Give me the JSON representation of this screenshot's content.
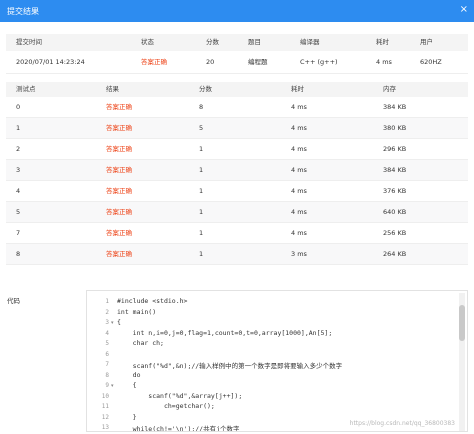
{
  "window": {
    "title": "提交结果",
    "close_glyph": "×"
  },
  "summary": {
    "headers": [
      "提交时间",
      "状态",
      "分数",
      "题目",
      "编译器",
      "耗时",
      "用户"
    ],
    "values": [
      "2020/07/01 14:23:24",
      "答案正确",
      "20",
      "编程题",
      "C++ (g++)",
      "4 ms",
      "620HZ"
    ]
  },
  "tests": {
    "headers": [
      "测试点",
      "结果",
      "分数",
      "耗时",
      "内存"
    ],
    "rows": [
      [
        "0",
        "答案正确",
        "8",
        "4 ms",
        "384 KB"
      ],
      [
        "1",
        "答案正确",
        "5",
        "4 ms",
        "380 KB"
      ],
      [
        "2",
        "答案正确",
        "1",
        "4 ms",
        "296 KB"
      ],
      [
        "3",
        "答案正确",
        "1",
        "4 ms",
        "384 KB"
      ],
      [
        "4",
        "答案正确",
        "1",
        "4 ms",
        "376 KB"
      ],
      [
        "5",
        "答案正确",
        "1",
        "4 ms",
        "640 KB"
      ],
      [
        "7",
        "答案正确",
        "1",
        "4 ms",
        "256 KB"
      ],
      [
        "8",
        "答案正确",
        "1",
        "3 ms",
        "264 KB"
      ]
    ]
  },
  "code_section": {
    "label": "代码",
    "line_numbers": [
      "1",
      "2",
      "3",
      "4",
      "5",
      "6",
      "7",
      "8",
      "9",
      "10",
      "11",
      "12",
      "13"
    ],
    "lines": [
      "#include <stdio.h>",
      "int main()",
      "{",
      "    int n,i=0,j=0,flag=1,count=0,t=0,array[1000],An[5];",
      "    char ch;",
      "",
      "    scanf(\"%d\",&n);//输入样例中的第一个数字是即将要输入多少个数字",
      "    do",
      "    {",
      "        scanf(\"%d\",&array[j++]);",
      "            ch=getchar();",
      "    }",
      "    while(ch!='\\n');//共有j个数字"
    ]
  },
  "watermark": "https://blog.csdn.net/qq_36800383"
}
